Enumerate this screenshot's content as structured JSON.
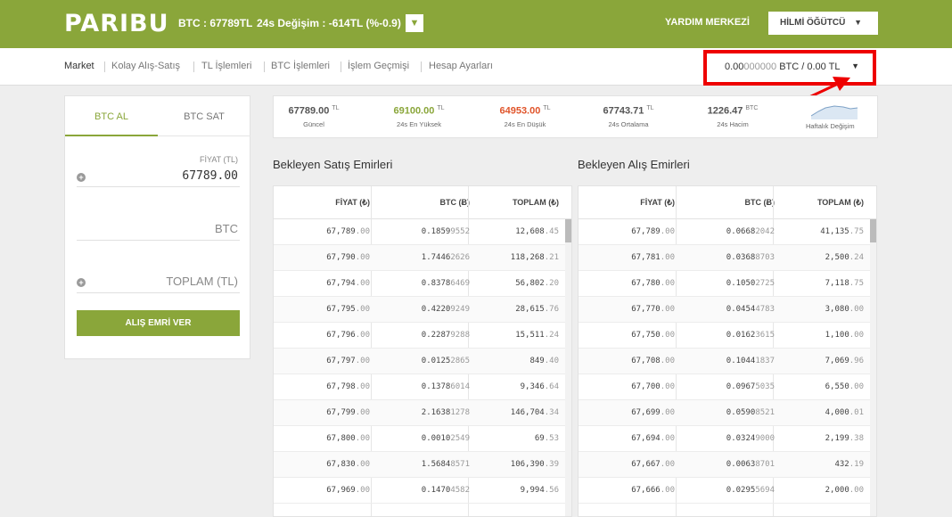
{
  "header": {
    "logo": "PARIBU",
    "btc_price": "BTC : 67789TL",
    "change": "24s Değişim : -614TL (%-0.9)",
    "help": "YARDIM MERKEZİ",
    "user": "HİLMİ ÖĞÜTCÜ"
  },
  "nav": [
    "Market",
    "Kolay Alış-Satış",
    "TL İşlemleri",
    "BTC İşlemleri",
    "İşlem Geçmişi",
    "Hesap Ayarları"
  ],
  "balance": {
    "bold": "0.00",
    "light": "000000",
    "rest": " BTC / 0.00 TL"
  },
  "order_form": {
    "tab_buy": "BTC AL",
    "tab_sell": "BTC SAT",
    "price_label": "FİYAT (TL)",
    "price_value": "67789.00",
    "btc_placeholder": "BTC",
    "total_placeholder": "TOPLAM (TL)",
    "submit": "ALIŞ EMRİ VER"
  },
  "stats": [
    {
      "value": "67789.00",
      "unit": "TL",
      "label": "Güncel",
      "color": "#555555"
    },
    {
      "value": "69100.00",
      "unit": "TL",
      "label": "24s En Yüksek",
      "color": "#8aa63a"
    },
    {
      "value": "64953.00",
      "unit": "TL",
      "label": "24s En Düşük",
      "color": "#e0552b"
    },
    {
      "value": "67743.71",
      "unit": "TL",
      "label": "24s Ortalama",
      "color": "#555555"
    },
    {
      "value": "1226.47",
      "unit": "BTC",
      "label": "24s Hacim",
      "color": "#555555"
    }
  ],
  "weekly_label": "Haftalık Değişim",
  "sell_book": {
    "title": "Bekleyen Satış Emirleri",
    "headers": [
      "FİYAT (₺)",
      "BTC (Ƀ)",
      "TOPLAM (₺)"
    ],
    "rows": [
      [
        [
          "67,789",
          ".00"
        ],
        [
          "0.1859",
          "9552"
        ],
        [
          "12,608",
          ".45"
        ]
      ],
      [
        [
          "67,790",
          ".00"
        ],
        [
          "1.7446",
          "2626"
        ],
        [
          "118,268",
          ".21"
        ]
      ],
      [
        [
          "67,794",
          ".00"
        ],
        [
          "0.8378",
          "6469"
        ],
        [
          "56,802",
          ".20"
        ]
      ],
      [
        [
          "67,795",
          ".00"
        ],
        [
          "0.4220",
          "9249"
        ],
        [
          "28,615",
          ".76"
        ]
      ],
      [
        [
          "67,796",
          ".00"
        ],
        [
          "0.2287",
          "9288"
        ],
        [
          "15,511",
          ".24"
        ]
      ],
      [
        [
          "67,797",
          ".00"
        ],
        [
          "0.0125",
          "2865"
        ],
        [
          "849",
          ".40"
        ]
      ],
      [
        [
          "67,798",
          ".00"
        ],
        [
          "0.1378",
          "6014"
        ],
        [
          "9,346",
          ".64"
        ]
      ],
      [
        [
          "67,799",
          ".00"
        ],
        [
          "2.1638",
          "1278"
        ],
        [
          "146,704",
          ".34"
        ]
      ],
      [
        [
          "67,800",
          ".00"
        ],
        [
          "0.0010",
          "2549"
        ],
        [
          "69",
          ".53"
        ]
      ],
      [
        [
          "67,830",
          ".00"
        ],
        [
          "1.5684",
          "8571"
        ],
        [
          "106,390",
          ".39"
        ]
      ],
      [
        [
          "67,969",
          ".00"
        ],
        [
          "0.1470",
          "4582"
        ],
        [
          "9,994",
          ".56"
        ]
      ]
    ]
  },
  "buy_book": {
    "title": "Bekleyen Alış Emirleri",
    "headers": [
      "FİYAT (₺)",
      "BTC (Ƀ)",
      "TOPLAM (₺)"
    ],
    "rows": [
      [
        [
          "67,789",
          ".00"
        ],
        [
          "0.0668",
          "2042"
        ],
        [
          "41,135",
          ".75"
        ]
      ],
      [
        [
          "67,781",
          ".00"
        ],
        [
          "0.0368",
          "8703"
        ],
        [
          "2,500",
          ".24"
        ]
      ],
      [
        [
          "67,780",
          ".00"
        ],
        [
          "0.1050",
          "2725"
        ],
        [
          "7,118",
          ".75"
        ]
      ],
      [
        [
          "67,770",
          ".00"
        ],
        [
          "0.0454",
          "4783"
        ],
        [
          "3,080",
          ".00"
        ]
      ],
      [
        [
          "67,750",
          ".00"
        ],
        [
          "0.0162",
          "3615"
        ],
        [
          "1,100",
          ".00"
        ]
      ],
      [
        [
          "67,708",
          ".00"
        ],
        [
          "0.1044",
          "1837"
        ],
        [
          "7,069",
          ".96"
        ]
      ],
      [
        [
          "67,700",
          ".00"
        ],
        [
          "0.0967",
          "5035"
        ],
        [
          "6,550",
          ".00"
        ]
      ],
      [
        [
          "67,699",
          ".00"
        ],
        [
          "0.0590",
          "8521"
        ],
        [
          "4,000",
          ".01"
        ]
      ],
      [
        [
          "67,694",
          ".00"
        ],
        [
          "0.0324",
          "9000"
        ],
        [
          "2,199",
          ".38"
        ]
      ],
      [
        [
          "67,667",
          ".00"
        ],
        [
          "0.0063",
          "8701"
        ],
        [
          "432",
          ".19"
        ]
      ],
      [
        [
          "67,666",
          ".00"
        ],
        [
          "0.0295",
          "5694"
        ],
        [
          "2,000",
          ".00"
        ]
      ]
    ]
  }
}
